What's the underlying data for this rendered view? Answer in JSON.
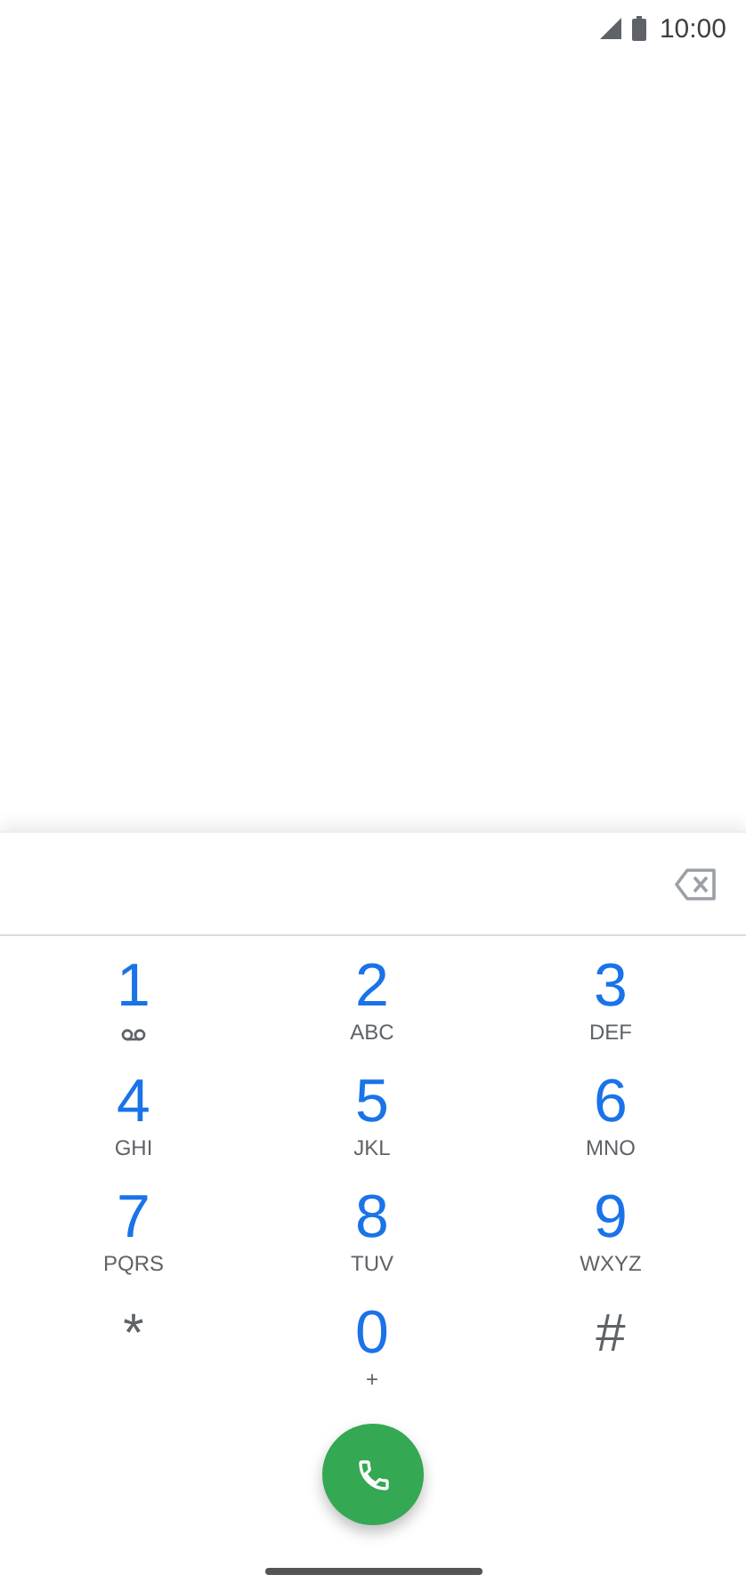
{
  "status_bar": {
    "time": "10:00"
  },
  "keypad": [
    {
      "kind": "voicemail",
      "digit": "1"
    },
    {
      "kind": "digit",
      "digit": "2",
      "letters": "ABC"
    },
    {
      "kind": "digit",
      "digit": "3",
      "letters": "DEF"
    },
    {
      "kind": "digit",
      "digit": "4",
      "letters": "GHI"
    },
    {
      "kind": "digit",
      "digit": "5",
      "letters": "JKL"
    },
    {
      "kind": "digit",
      "digit": "6",
      "letters": "MNO"
    },
    {
      "kind": "digit",
      "digit": "7",
      "letters": "PQRS"
    },
    {
      "kind": "digit",
      "digit": "8",
      "letters": "TUV"
    },
    {
      "kind": "digit",
      "digit": "9",
      "letters": "WXYZ"
    },
    {
      "kind": "symbol",
      "digit": "*"
    },
    {
      "kind": "digit",
      "digit": "0",
      "letters": "+"
    },
    {
      "kind": "symbol",
      "digit": "#"
    }
  ]
}
